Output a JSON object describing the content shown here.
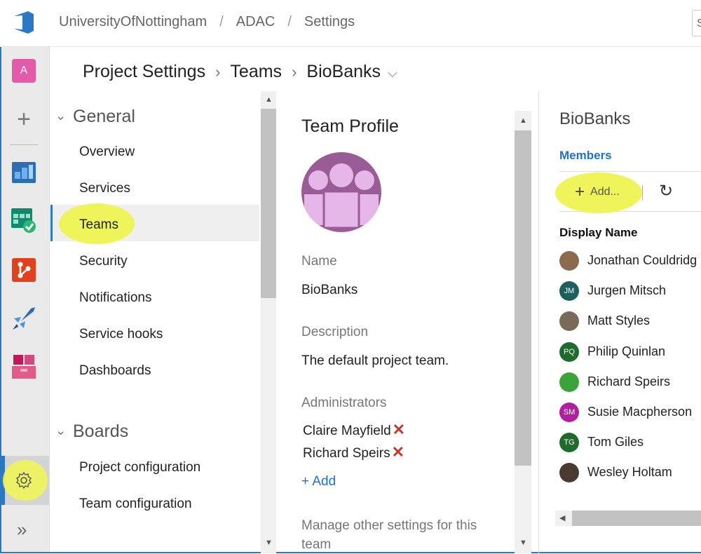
{
  "topbar": {
    "breadcrumbs": [
      "UniversityOfNottingham",
      "ADAC",
      "Settings"
    ],
    "search_stub": "S",
    "logo_icon": "azure-devops-logo-icon"
  },
  "leftnav": {
    "avatar_letter": "A",
    "icons": [
      "plus-icon",
      "overview-icon",
      "boards-icon",
      "repos-icon",
      "pipelines-icon",
      "artifacts-icon",
      "gear-icon",
      "expand-chevrons-icon"
    ]
  },
  "heading": {
    "root": "Project Settings",
    "section": "Teams",
    "team": "BioBanks"
  },
  "tree": {
    "general": {
      "label": "General",
      "items": [
        "Overview",
        "Services",
        "Teams",
        "Security",
        "Notifications",
        "Service hooks",
        "Dashboards"
      ]
    },
    "boards": {
      "label": "Boards",
      "items": [
        "Project configuration",
        "Team configuration"
      ]
    },
    "selected": "Teams"
  },
  "profile": {
    "title": "Team Profile",
    "name_label": "Name",
    "name_value": "BioBanks",
    "description_label": "Description",
    "description_value": "The default project team.",
    "administrators_label": "Administrators",
    "administrators": [
      "Claire Mayfield",
      "Richard Speirs"
    ],
    "add_label": "+ Add",
    "manage_text": "Manage other settings for this team"
  },
  "members": {
    "title": "BioBanks",
    "tab": "Members",
    "add_button": "Add...",
    "column_header": "Display Name",
    "list": [
      {
        "name": "Jonathan Couldridg",
        "initials": "",
        "color": "#8a6b4e"
      },
      {
        "name": "Jurgen Mitsch",
        "initials": "JM",
        "color": "#1e5e5e"
      },
      {
        "name": "Matt Styles",
        "initials": "",
        "color": "#7a6a5a"
      },
      {
        "name": "Philip Quinlan",
        "initials": "PQ",
        "color": "#1f6b2e"
      },
      {
        "name": "Richard Speirs",
        "initials": "",
        "color": "#3aa33a"
      },
      {
        "name": "Susie Macpherson",
        "initials": "SM",
        "color": "#b01fa0"
      },
      {
        "name": "Tom Giles",
        "initials": "TG",
        "color": "#1f6b2e"
      },
      {
        "name": "Wesley Holtam",
        "initials": "",
        "color": "#4a3a30"
      }
    ]
  },
  "colors": {
    "accent": "#2b79c2",
    "highlight": "#eef45a",
    "link": "#1f73c7",
    "remove": "#c0392b"
  }
}
